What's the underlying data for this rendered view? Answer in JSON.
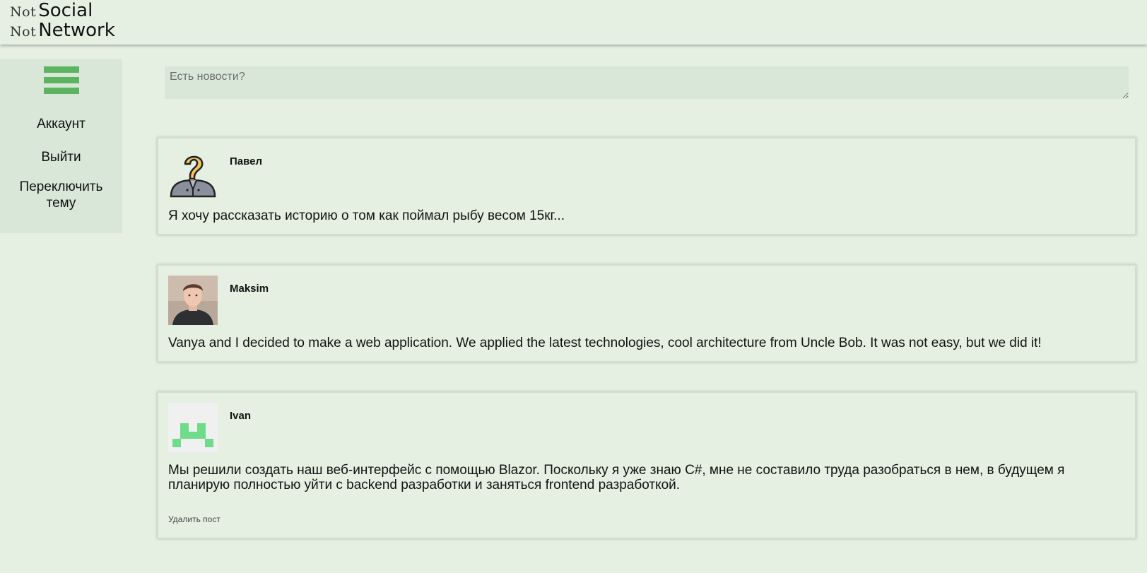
{
  "header": {
    "logo_line1_not": "Not",
    "logo_line1_word": "Social",
    "logo_line2_not": "Not",
    "logo_line2_word": "Network"
  },
  "sidebar": {
    "menu_icon": "hamburger-menu-icon",
    "items": [
      {
        "label": "Аккаунт"
      },
      {
        "label": "Выйти"
      },
      {
        "label": "Переключить тему"
      }
    ]
  },
  "composer": {
    "placeholder": "Есть новости?"
  },
  "posts": [
    {
      "author": "Павел",
      "avatar": "question-person-icon",
      "text": "Я хочу рассказать историю о том как поймал рыбу весом 15кг..."
    },
    {
      "author": "Maksim",
      "avatar": "user-photo",
      "text": "Vanya and I decided to make a web application. We applied the latest technologies, cool architecture from Uncle Bob. It was not easy, but we did it!"
    },
    {
      "author": "Ivan",
      "avatar": "identicon",
      "text": "Мы решили создать наш веб-интерфейс с помощью Blazor. Поскольку я уже знаю C#, мне не составило труда разобраться в нем, в будущем я планирую полностью уйти с backend разработки и заняться frontend разработкой.",
      "delete_label": "Удалить пост"
    }
  ],
  "colors": {
    "background": "#e5f0e3",
    "panel": "#d8e7d7",
    "accent": "#5cb360",
    "identicon": "#6fdc8c"
  }
}
